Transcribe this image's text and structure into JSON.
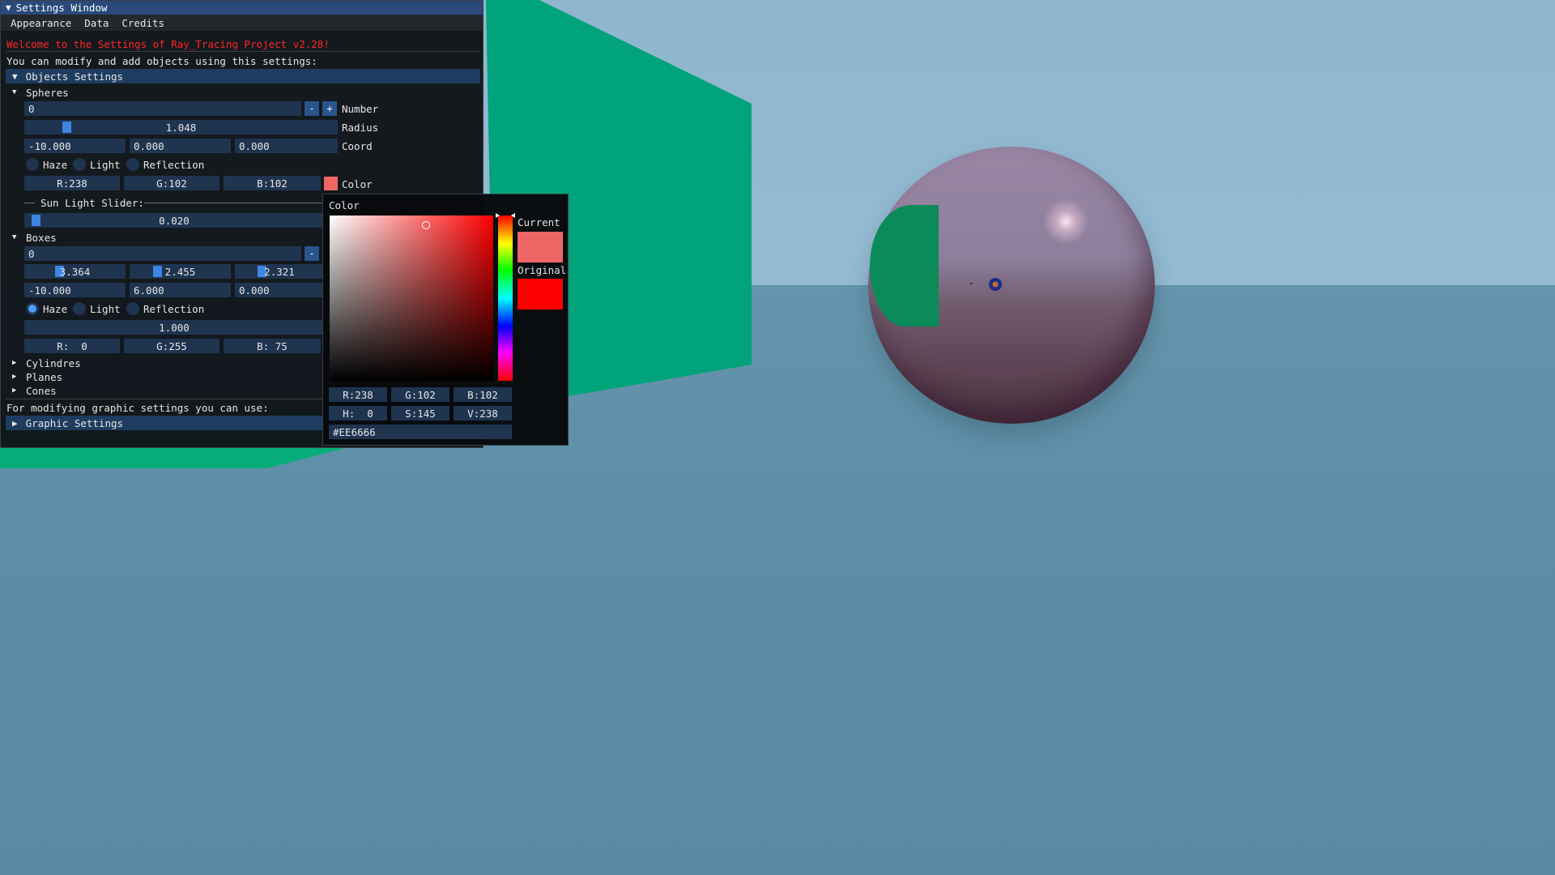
{
  "colors": {
    "window_bg": "#0f1418",
    "title_active": "#294a7a",
    "frame_bg": "#1f344f",
    "accent": "#3d85e0",
    "welcome_text": "#ff2626",
    "wall": "#00a87a",
    "current_color": "#EE6666",
    "original_color": "#FF0000",
    "box_color": "#00FF4B"
  },
  "window": {
    "title": "Settings Window",
    "collapse_icon": "triangle-down-icon",
    "menu": [
      "Appearance",
      "Data",
      "Credits"
    ],
    "welcome": "Welcome to the Settings of Ray_Tracing Project v2.28!",
    "intro": "You can modify and add objects using this settings:",
    "objects_header": "Objects Settings",
    "graphic_text": "For modifying graphic settings you can use:",
    "graphic_header": "Graphic Settings"
  },
  "spheres": {
    "label": "Spheres",
    "number_value": "0",
    "minus": "-",
    "plus": "+",
    "number_label": "Number",
    "radius_value": "1.048",
    "radius_label": "Radius",
    "radius_fraction": 0.12,
    "coord": [
      "-10.000",
      "0.000",
      "0.000"
    ],
    "coord_label": "Coord",
    "haze": "Haze",
    "light": "Light",
    "reflection": "Reflection",
    "rgb": [
      "R:238",
      "G:102",
      "B:102"
    ],
    "color_label": "Color",
    "sun_label": "Sun Light Slider:",
    "sun_value": "0.020",
    "sun_fraction": 0.02
  },
  "boxes": {
    "label": "Boxes",
    "number_value": "0",
    "minus": "-",
    "size": [
      "3.364",
      "2.455",
      "2.321"
    ],
    "coord": [
      "-10.000",
      "6.000",
      "0.000"
    ],
    "haze": "Haze",
    "light": "Light",
    "reflection": "Reflection",
    "value": "1.000",
    "rgb": [
      "R:  0",
      "G:255",
      "B: 75"
    ]
  },
  "collapsed": [
    "Cylindres",
    "Planes",
    "Cones"
  ],
  "picker": {
    "title": "Color",
    "current_label": "Current",
    "original_label": "Original",
    "rgb": [
      "R:238",
      "G:102",
      "B:102"
    ],
    "hsv": [
      "H:  0",
      "S:145",
      "V:238"
    ],
    "hex": "#EE6666"
  }
}
